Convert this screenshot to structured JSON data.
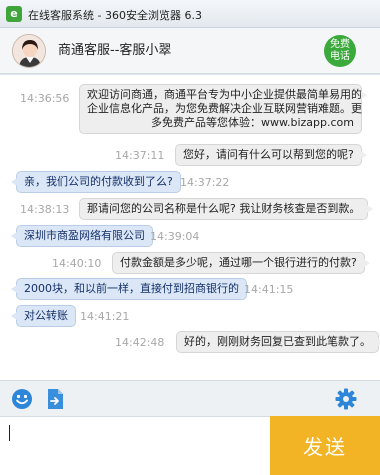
{
  "window": {
    "title": "在线客服系统 - 360安全浏览器 6.3"
  },
  "header": {
    "name": "商通客服--客服小翠",
    "free_call": [
      "免费",
      "电话"
    ]
  },
  "messages": [
    {
      "role": "agent",
      "time": "14:36:56",
      "lines": [
        "欢迎访问商通，商通平台专为中小企业提供最简单易用的",
        "企业信息化产品，为您免费解决企业互联网营销难题。更",
        "多免费产品等您体验：www.bizapp.com"
      ]
    },
    {
      "role": "agent",
      "time": "14:37:11",
      "lines": [
        "您好，请问有什么可以帮到您的呢?"
      ]
    },
    {
      "role": "user",
      "time": "14:37:22",
      "lines": [
        "亲，我们公司的付款收到了么?"
      ]
    },
    {
      "role": "agent",
      "time": "14:38:13",
      "lines": [
        "那请问您的公司名称是什么呢? 我让财务核查是否到款。"
      ]
    },
    {
      "role": "user",
      "time": "14:39:04",
      "lines": [
        "深圳市商盈网络有限公司"
      ]
    },
    {
      "role": "agent",
      "time": "14:40:10",
      "lines": [
        "付款金额是多少呢，通过哪一个银行进行的付款?"
      ]
    },
    {
      "role": "user",
      "time": "14:41:15",
      "lines": [
        "2000块，和以前一样，直接付到招商银行的"
      ]
    },
    {
      "role": "user",
      "time": "14:41:21",
      "lines": [
        "对公转账"
      ]
    },
    {
      "role": "agent",
      "time": "14:42:48",
      "lines": [
        "好的，刚刚财务回复已查到此笔款了。"
      ]
    }
  ],
  "composer": {
    "value": "",
    "send_label": "发送"
  },
  "colors": {
    "send": "#f2b324",
    "free_call": "#3ba93b",
    "user_bubble": "#dbe7f6",
    "agent_bubble": "#eeeeee"
  },
  "icons": [
    "browser-app-icon",
    "customer-service-avatar",
    "emoji-icon",
    "file-send-icon",
    "settings-gear-icon"
  ]
}
